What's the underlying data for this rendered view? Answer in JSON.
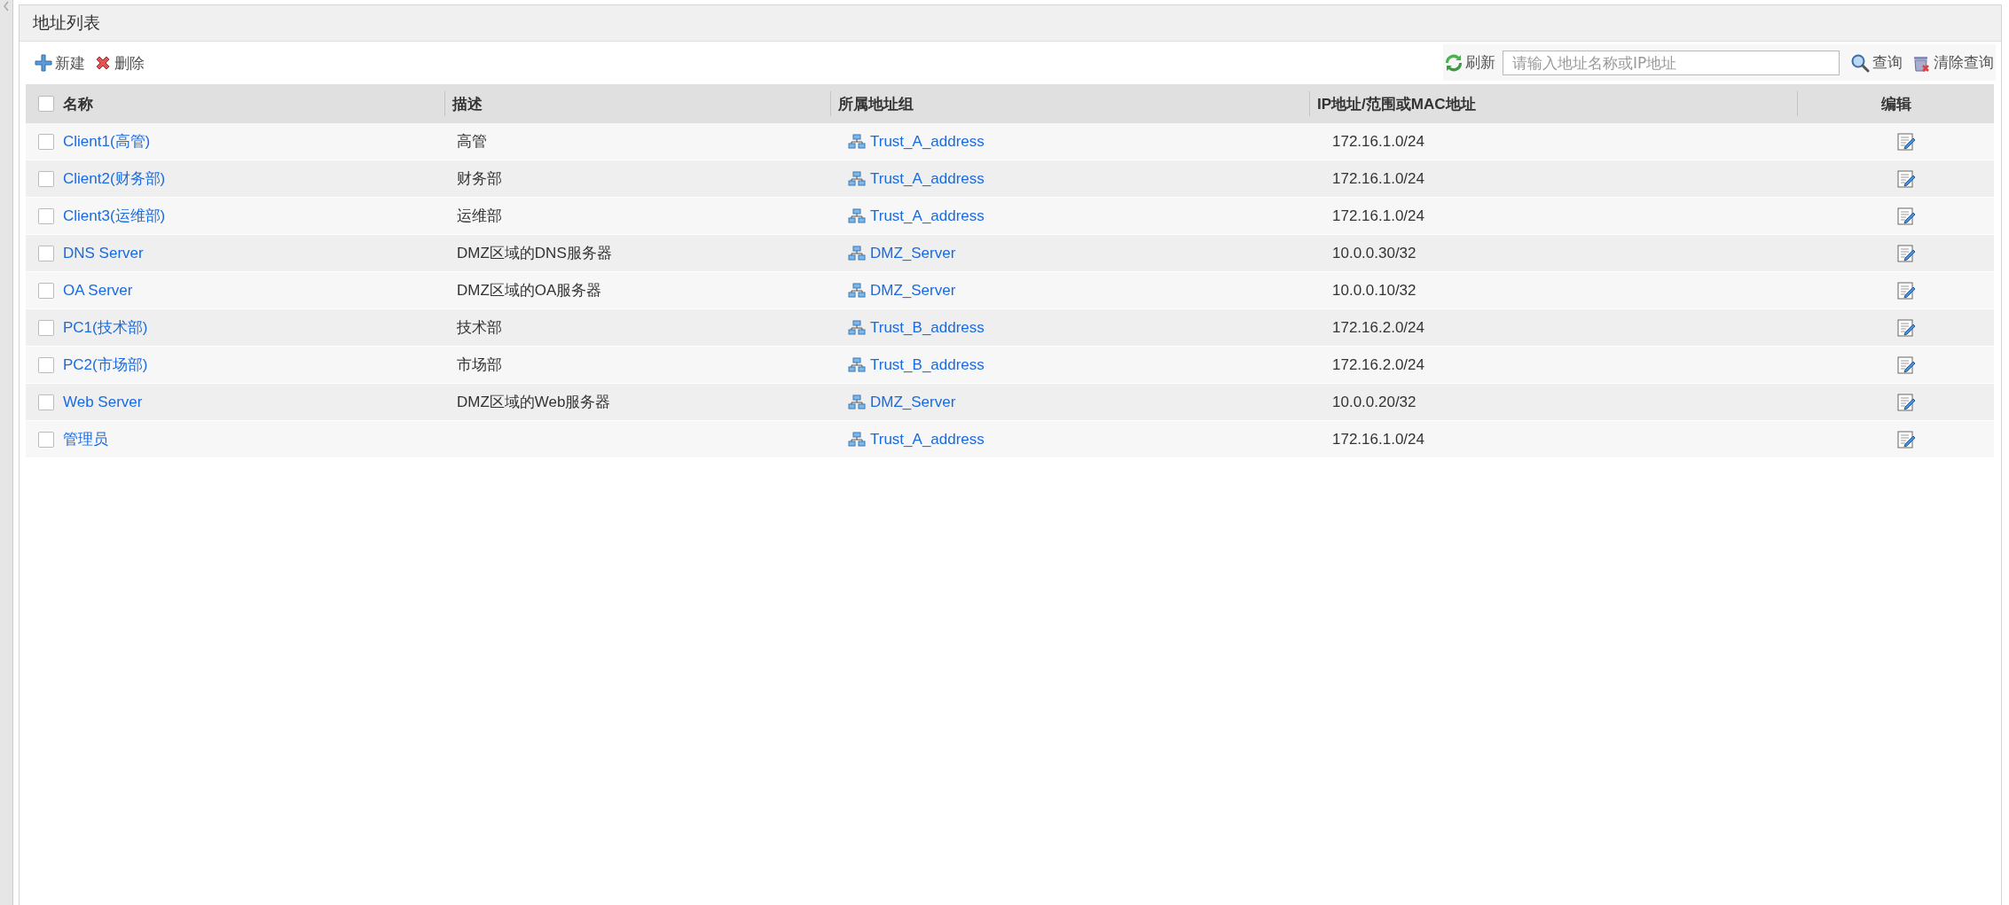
{
  "panel": {
    "title": "地址列表"
  },
  "toolbar": {
    "left": [
      {
        "kind": "add",
        "label": "新建"
      },
      {
        "kind": "delete",
        "label": "删除"
      }
    ],
    "refresh": {
      "label": "刷新"
    },
    "search": {
      "placeholder": "请输入地址名称或IP地址"
    },
    "right": [
      {
        "kind": "query",
        "label": "查询"
      },
      {
        "kind": "clear",
        "label": "清除查询"
      }
    ]
  },
  "table": {
    "select_all": {
      "checked": false
    },
    "columns": [
      "名称",
      "描述",
      "所属地址组",
      "IP地址/范围或MAC地址",
      "编辑"
    ],
    "rows": [
      {
        "checked": false,
        "name": "Client1(高管)",
        "description": "高管",
        "group": "Trust_A_address",
        "address": "172.16.1.0/24"
      },
      {
        "checked": false,
        "name": "Client2(财务部)",
        "description": "财务部",
        "group": "Trust_A_address",
        "address": "172.16.1.0/24"
      },
      {
        "checked": false,
        "name": "Client3(运维部)",
        "description": "运维部",
        "group": "Trust_A_address",
        "address": "172.16.1.0/24"
      },
      {
        "checked": false,
        "name": "DNS Server",
        "description": "DMZ区域的DNS服务器",
        "group": "DMZ_Server",
        "address": "10.0.0.30/32"
      },
      {
        "checked": false,
        "name": "OA Server",
        "description": "DMZ区域的OA服务器",
        "group": "DMZ_Server",
        "address": "10.0.0.10/32"
      },
      {
        "checked": false,
        "name": "PC1(技术部)",
        "description": "技术部",
        "group": "Trust_B_address",
        "address": "172.16.2.0/24"
      },
      {
        "checked": false,
        "name": "PC2(市场部)",
        "description": "市场部",
        "group": "Trust_B_address",
        "address": "172.16.2.0/24"
      },
      {
        "checked": false,
        "name": "Web Server",
        "description": "DMZ区域的Web服务器",
        "group": "DMZ_Server",
        "address": "10.0.0.20/32"
      },
      {
        "checked": false,
        "name": "管理员",
        "group": "Trust_A_address",
        "address": "172.16.1.0/24"
      }
    ]
  }
}
